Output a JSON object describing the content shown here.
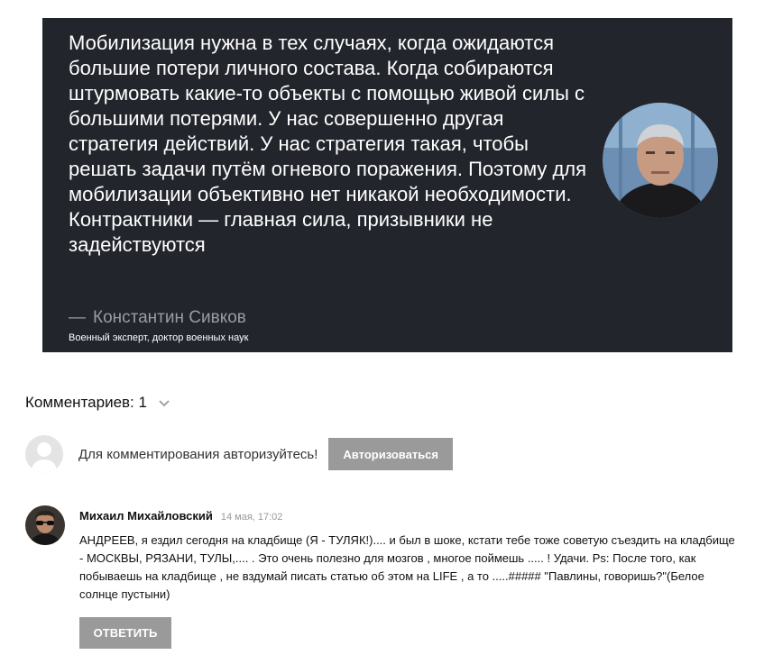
{
  "quote": {
    "text": "Мобилизация нужна в тех случаях, когда ожидаются большие потери личного состава. Когда собираются штурмовать какие-то объекты с помощью живой силы с большими потерями. У нас совершенно другая стратегия действий. У нас стратегия такая, чтобы решать задачи путём огневого поражения. Поэтому для мобилизации объективно нет никакой необходимости. Контрактники — главная сила, призывники не задействуются",
    "author_dash": "—",
    "author": "Константин Сивков",
    "author_title": "Военный эксперт, доктор военных наук"
  },
  "comments": {
    "header": "Комментариев: 1",
    "auth_prompt": "Для комментирования авторизуйтесь!",
    "auth_button": "Авторизоваться",
    "items": [
      {
        "author": "Михаил Михайловский",
        "date": "14 мая, 17:02",
        "text": "АНДРЕЕВ, я ездил сегодня на кладбище (Я - ТУЛЯК!).... и был в шоке, кстати тебе тоже советую съездить на кладбище - МОСКВЫ, РЯЗАНИ, ТУЛЫ,.... . Это очень полезно для мозгов , многое поймешь ..... ! Удачи. Ps: После того, как побываешь на кладбище , не вздумай писать статью об этом на LIFE , а то .....##### \"Павлины, говоришь?\"(Белое солнце пустыни)",
        "reply_button": "ОТВЕТИТЬ"
      }
    ]
  },
  "icons": {
    "chevron": "chevron-down-icon",
    "guest_avatar": "user-placeholder-icon"
  },
  "colors": {
    "card_bg": "#23252d",
    "button_bg": "#9a9a9a",
    "author_gray": "#9a9ca2"
  }
}
